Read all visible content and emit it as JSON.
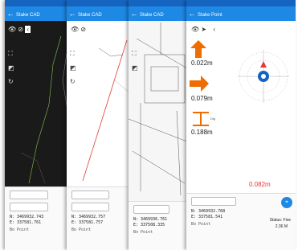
{
  "screens": [
    {
      "title": "Stake CAD",
      "n": "N: 3469932.743",
      "e": "E: 337581.761",
      "tool": "Bo Point"
    },
    {
      "title": "Stake CAD",
      "n": "N: 3469932.757",
      "e": "E: 337581.757",
      "tool": "Bo Point"
    },
    {
      "title": "Stake CAD",
      "n": "N: 3469936.761",
      "e": "E: 337508.335",
      "tool": "Bo Point"
    },
    {
      "title": "Stake Point",
      "n": "N: 3469932.768",
      "e": "E: 337581.541",
      "tool": "Bo Point"
    }
  ],
  "stake": {
    "north": "0.022m",
    "east": "0.079m",
    "dig": "0.188m",
    "dig_label": "Dig",
    "distance": "0.082m",
    "status_label": "Status: Fixe",
    "status_value": "2.36 M"
  },
  "colors": {
    "appbar": "#1e88e5",
    "arrow": "#ef6c00",
    "distance": "#e53935"
  }
}
